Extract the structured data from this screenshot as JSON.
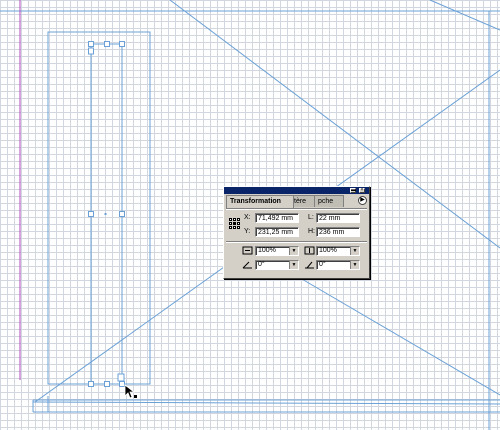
{
  "palette": {
    "tabs": {
      "transformation": "Transformation",
      "tab2": "tère",
      "tab3": "pche"
    },
    "menu_arrow_glyph": "▶",
    "fields": {
      "x_label": "X:",
      "x_value": "71,492 mm",
      "y_label": "Y:",
      "y_value": "231,25 mm",
      "w_label": "L:",
      "w_value": "22 mm",
      "h_label": "H:",
      "h_value": "236 mm",
      "scale_x": "100%",
      "scale_y": "100%",
      "rotate": "0°",
      "shear": "0°"
    },
    "icons": {
      "scale_x": "scale-horizontal-icon",
      "scale_y": "scale-vertical-icon",
      "rotate": "rotate-icon",
      "shear": "shear-icon",
      "dropdown": "▼",
      "close": "×",
      "minimize": "▬"
    }
  },
  "colors": {
    "guide": "#5b8fc7",
    "grid": "#d2d6de",
    "margin_guide": "#b04ac0",
    "title_bar": "#0a246a",
    "panel_bg": "#d4d0c8"
  }
}
